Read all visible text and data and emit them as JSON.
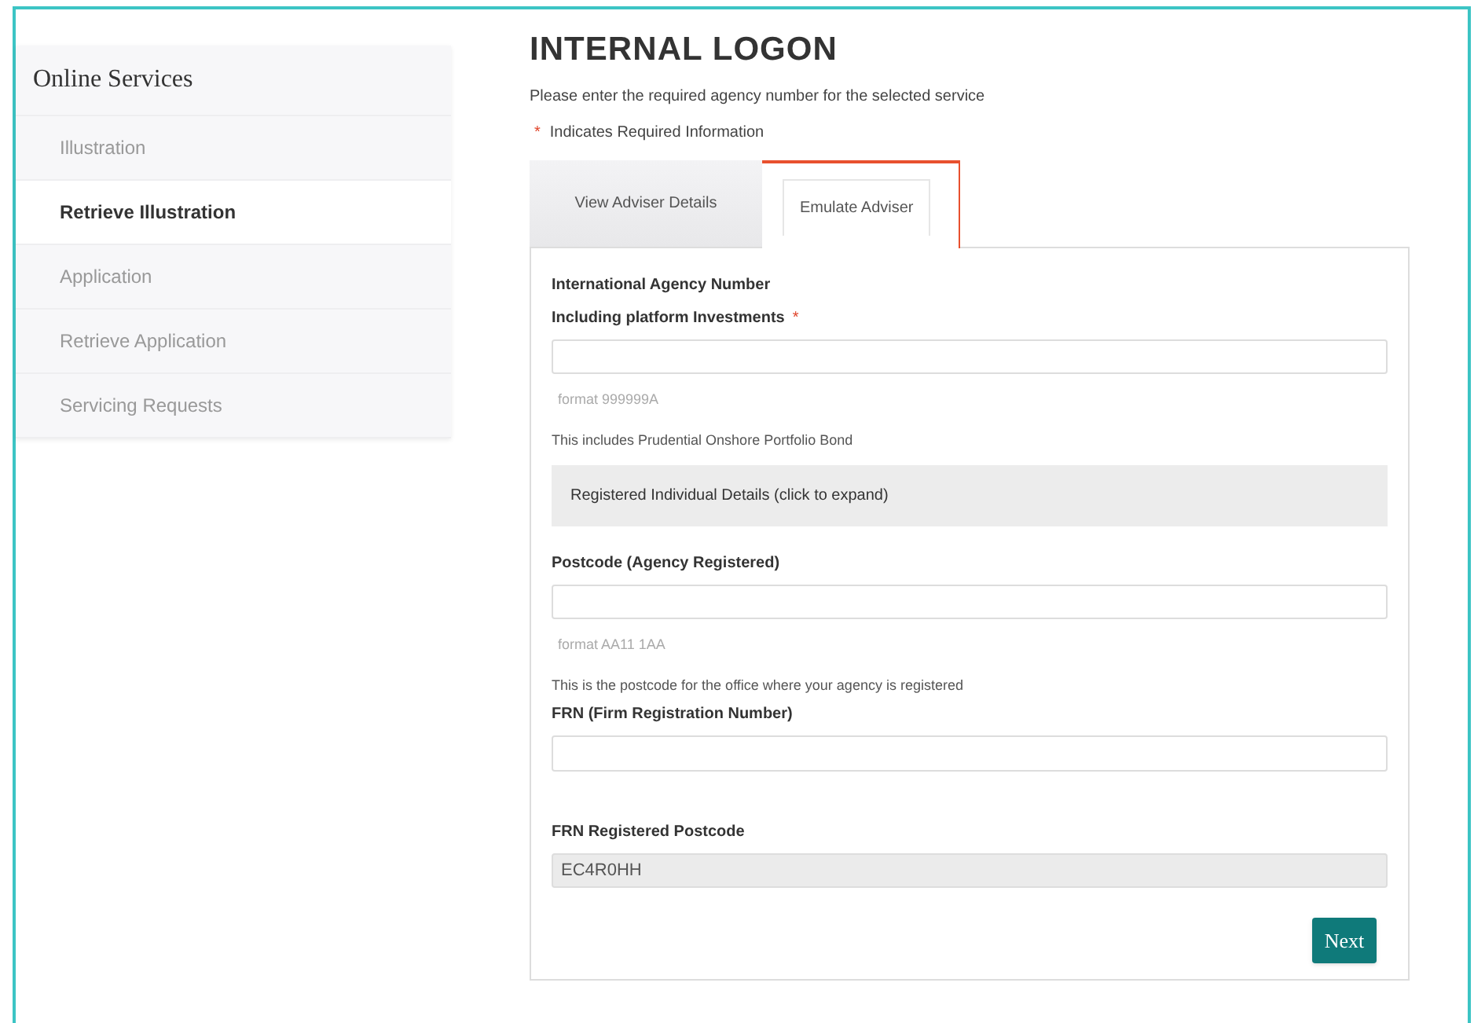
{
  "sidebar": {
    "title": "Online Services",
    "items": [
      {
        "label": "Illustration",
        "selected": false
      },
      {
        "label": "Retrieve Illustration",
        "selected": true
      },
      {
        "label": "Application",
        "selected": false
      },
      {
        "label": "Retrieve Application",
        "selected": false
      },
      {
        "label": "Servicing Requests",
        "selected": false
      }
    ]
  },
  "page": {
    "title": "INTERNAL LOGON",
    "intro": "Please enter the required agency number for the selected service",
    "required_legend": {
      "mark": "*",
      "text": "Indicates Required Information"
    }
  },
  "tabs": [
    {
      "label": "View Adviser Details",
      "selected": false
    },
    {
      "label": "Emulate Adviser",
      "selected": true
    }
  ],
  "form": {
    "items": [
      {
        "kind": "field",
        "label_lines": [
          "International Agency Number",
          "Including platform Investments"
        ],
        "required_mark": "*",
        "disabled": false,
        "hint": "format 999999A",
        "note": "This includes Prudential Onshore Portfolio Bond"
      },
      {
        "kind": "expander",
        "label": "Registered Individual Details (click to expand)"
      },
      {
        "kind": "field",
        "label_lines": [
          "Postcode (Agency Registered)"
        ],
        "disabled": false,
        "hint": "format AA11 1AA",
        "note": "This is the postcode for the office where your agency is registered"
      },
      {
        "kind": "field",
        "label_lines": [
          "FRN (Firm Registration Number)"
        ],
        "disabled": false
      },
      {
        "kind": "spacer"
      },
      {
        "kind": "field",
        "label_lines": [
          "FRN Registered Postcode"
        ],
        "value": "EC4R0HH",
        "disabled": true
      }
    ],
    "submit": "Next"
  }
}
